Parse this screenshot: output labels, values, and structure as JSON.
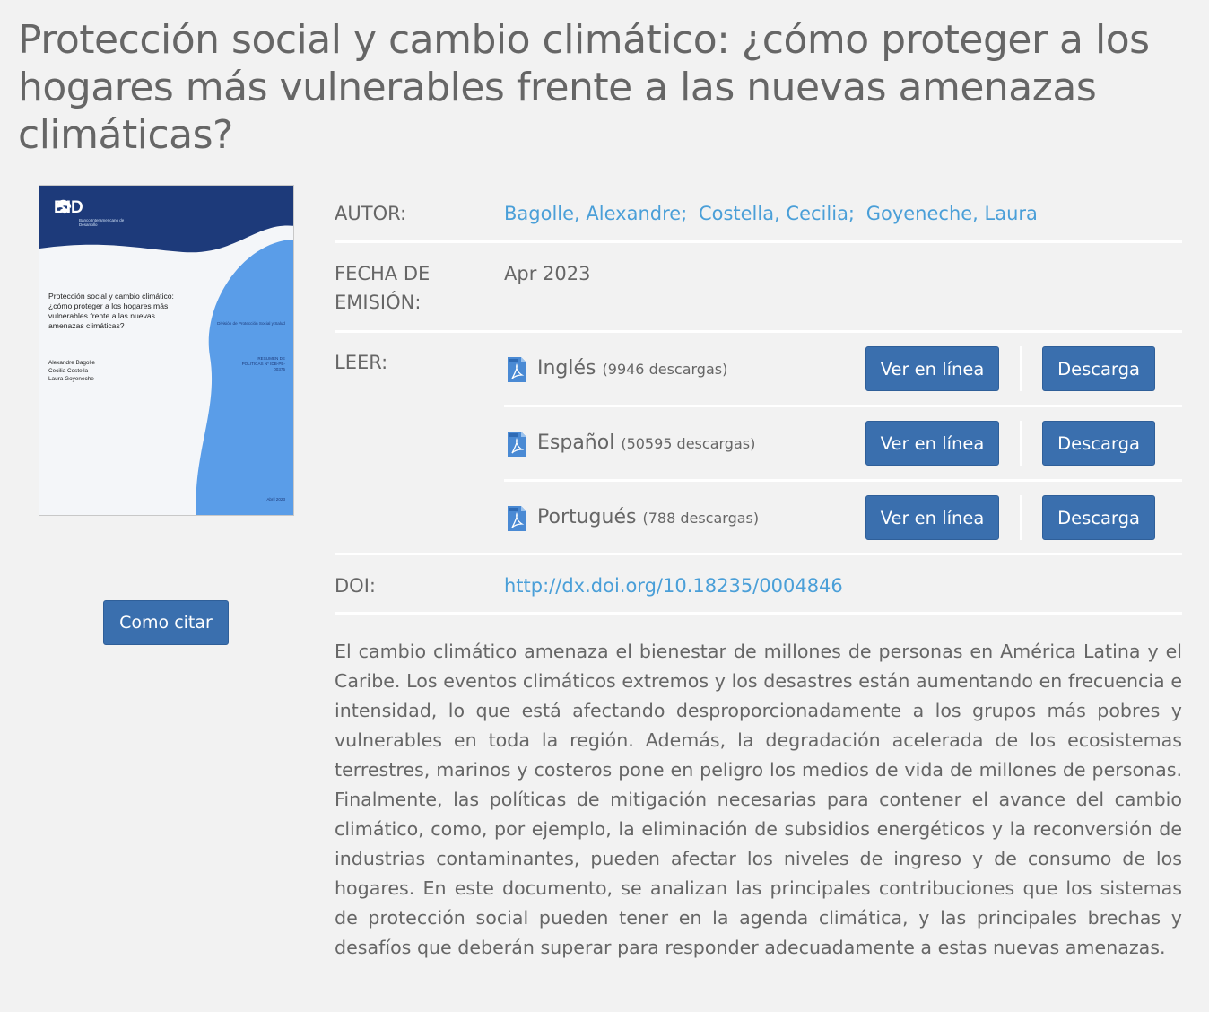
{
  "title": "Protección social y cambio climático: ¿cómo proteger a los hogares más vulnerables frente a las nuevas amenazas climáticas?",
  "cover": {
    "logo_text": "BID",
    "logo_sub": "Banco Interamericano de Desarrollo",
    "title": "Protección social y cambio climático: ¿cómo proteger a los hogares más vulnerables frente a las nuevas amenazas climáticas?",
    "authors": "Alexandre Bagolle\nCecilia Costella\nLaura Goyeneche",
    "division": "División de Protección Social y Salud",
    "series": "RESUMEN DE POLÍTICAS Nº IDB-PB-00375",
    "date": "Abril 2023",
    "colors": {
      "dark_blue": "#1d3a7a",
      "light_blue": "#5a9de8"
    }
  },
  "cite_button": "Como citar",
  "meta": {
    "author_label": "AUTOR:",
    "authors": [
      "Bagolle, Alexandre;",
      "Costella, Cecilia;",
      "Goyeneche, Laura"
    ],
    "date_label": "FECHA DE EMISIÓN:",
    "date_value": "Apr 2023",
    "read_label": "LEER:",
    "doi_label": "DOI:",
    "doi_value": "http://dx.doi.org/10.18235/0004846"
  },
  "languages": [
    {
      "name": "Inglés",
      "count": "(9946 descargas)",
      "view": "Ver en línea",
      "download": "Descarga"
    },
    {
      "name": "Español",
      "count": "(50595 descargas)",
      "view": "Ver en línea",
      "download": "Descarga"
    },
    {
      "name": "Portugués",
      "count": "(788 descargas)",
      "view": "Ver en línea",
      "download": "Descarga"
    }
  ],
  "abstract": "El cambio climático amenaza el bienestar de millones de personas en América Latina y el Caribe. Los eventos climáticos extremos y los desastres están aumentando en frecuencia e intensidad, lo que está afectando desproporcionadamente a los grupos más pobres y vulnerables en toda la región. Además, la degradación acelerada de los ecosistemas terrestres, marinos y costeros pone en peligro los medios de vida de millones de personas. Finalmente, las políticas de mitigación necesarias para contener el avance del cambio climático, como, por ejemplo, la eliminación de subsidios energéticos y la reconversión de industrias contaminantes, pueden afectar los niveles de ingreso y de consumo de los hogares. En este documento, se analizan las principales contribuciones que los sistemas de protección social pueden tener en la agenda climática, y las principales brechas y desafíos que deberán superar para responder adecuadamente a estas nuevas amenazas.",
  "colors": {
    "accent": "#3a6fae",
    "link": "#4a9fd8",
    "background": "#f2f2f2"
  },
  "icons": {
    "file": "pdf-icon"
  }
}
